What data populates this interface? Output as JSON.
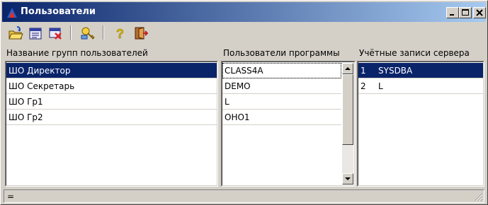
{
  "window": {
    "title": "Пользователи",
    "controls": [
      "minimize",
      "maximize",
      "close"
    ]
  },
  "toolbar": {
    "buttons": [
      "open-folder-icon",
      "edit-list-icon",
      "delete-record-icon",
      "key-users-icon",
      "help-question-icon",
      "exit-door-icon"
    ]
  },
  "groups": {
    "header": "Название групп пользователей",
    "items": [
      "ШО  Директор",
      "ШО  Секретарь",
      "ШО  Гр1",
      "ШО  Гр2"
    ],
    "selected_index": 0
  },
  "program_users": {
    "header": "Пользователи программы",
    "items": [
      "CLASS4A",
      "DEMO",
      "L",
      "OHO1"
    ],
    "focused_index": 0
  },
  "server_accounts": {
    "header": "Учётные записи сервера",
    "items": [
      {
        "num": "1",
        "name": "SYSDBA"
      },
      {
        "num": "2",
        "name": "L"
      }
    ],
    "selected_index": 0
  },
  "status": {
    "text": "="
  },
  "colors": {
    "title_start": "#0a246a",
    "title_end": "#a6caf0",
    "selection": "#0a246a",
    "face": "#d4d0c8"
  }
}
